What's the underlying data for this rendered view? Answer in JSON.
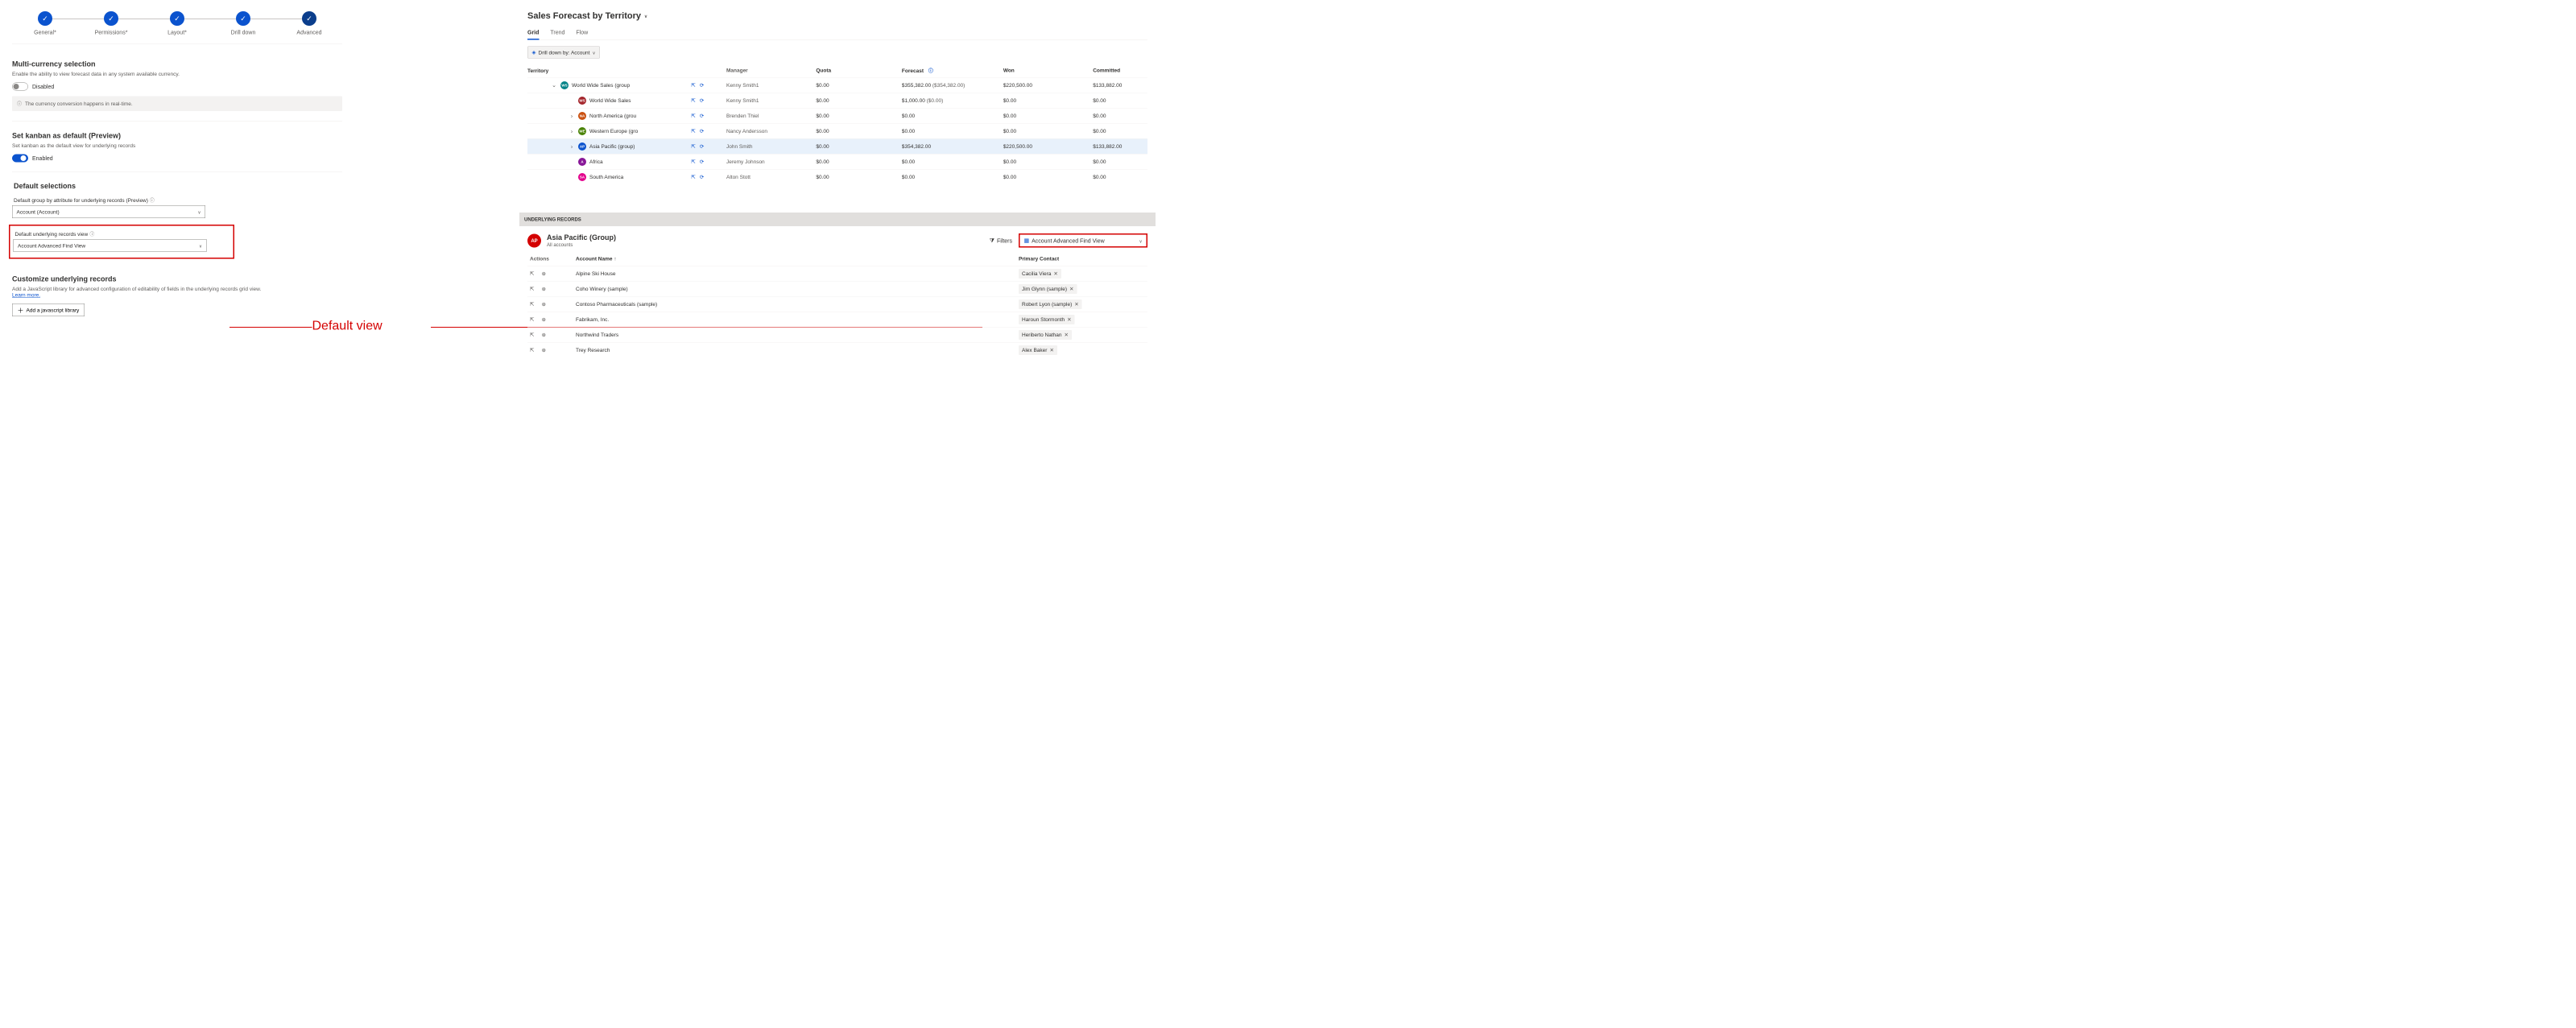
{
  "stepper": {
    "steps": [
      {
        "label": "General*"
      },
      {
        "label": "Permissions*"
      },
      {
        "label": "Layout*"
      },
      {
        "label": "Drill down"
      },
      {
        "label": "Advanced"
      }
    ]
  },
  "multicurrency": {
    "title": "Multi-currency selection",
    "desc": "Enable the ability to view forecast data in any system available currency.",
    "toggle_label": "Disabled",
    "info": "The currency conversion happens in real-time."
  },
  "kanban": {
    "title": "Set kanban as default (Preview)",
    "desc": "Set kanban as the default view for underlying records",
    "toggle_label": "Enabled"
  },
  "defaults": {
    "title": "Default selections",
    "group_by_label": "Default group by attribute for underlying records (Preview)",
    "group_by_value": "Account (Account)",
    "view_label": "Default underlying records view",
    "view_value": "Account Advanced Find View"
  },
  "customize": {
    "title": "Customize underlying records",
    "desc_a": "Add a JavaScript library for advanced configuration of editability of fields in the underlying records grid view. ",
    "learn_more": "Learn more.",
    "button": "Add a javascript library"
  },
  "annotation": {
    "label": "Default view"
  },
  "forecast": {
    "title": "Sales Forecast by Territory",
    "tabs": {
      "grid": "Grid",
      "trend": "Trend",
      "flow": "Flow"
    },
    "drill_label": "Drill down by: Account",
    "columns": {
      "territory": "Territory",
      "manager": "Manager",
      "quota": "Quota",
      "forecast": "Forecast",
      "won": "Won",
      "committed": "Committed"
    },
    "rows": [
      {
        "indent": 0,
        "expand": "d",
        "av": "WS",
        "avbg": "#038387",
        "name": "World Wide Sales (group",
        "mgr": "Kenny Smith1",
        "quota": "$0.00",
        "fc": "$355,382.00",
        "fcp": "($354,382.00)",
        "won": "$220,500.00",
        "comm": "$133,882.00",
        "hl": false
      },
      {
        "indent": 1,
        "expand": "",
        "av": "WS",
        "avbg": "#a4262c",
        "name": "World Wide Sales",
        "mgr": "Kenny Smith1",
        "quota": "$0.00",
        "fc": "$1,000.00",
        "fcp": "($0.00)",
        "won": "$0.00",
        "comm": "$0.00",
        "hl": false
      },
      {
        "indent": 1,
        "expand": "r",
        "av": "NA",
        "avbg": "#ca5010",
        "name": "North America (grou",
        "mgr": "Brenden Thiel",
        "quota": "$0.00",
        "fc": "$0.00",
        "fcp": "",
        "won": "$0.00",
        "comm": "$0.00",
        "hl": false
      },
      {
        "indent": 1,
        "expand": "r",
        "av": "WE",
        "avbg": "#498205",
        "name": "Western Europe (gro",
        "mgr": "Nancy Andersson",
        "quota": "$0.00",
        "fc": "$0.00",
        "fcp": "",
        "won": "$0.00",
        "comm": "$0.00",
        "hl": false
      },
      {
        "indent": 1,
        "expand": "r",
        "av": "AP",
        "avbg": "#0b53ce",
        "name": "Asia Pacific (group)",
        "mgr": "John Smith",
        "quota": "$0.00",
        "fc": "$354,382.00",
        "fcp": "",
        "won": "$220,500.00",
        "comm": "$133,882.00",
        "hl": true
      },
      {
        "indent": 1,
        "expand": "",
        "av": "A",
        "avbg": "#881798",
        "name": "Africa",
        "mgr": "Jeremy Johnson",
        "quota": "$0.00",
        "fc": "$0.00",
        "fcp": "",
        "won": "$0.00",
        "comm": "$0.00",
        "hl": false
      },
      {
        "indent": 1,
        "expand": "",
        "av": "SA",
        "avbg": "#e3008c",
        "name": "South America",
        "mgr": "Alton Stott",
        "quota": "$0.00",
        "fc": "$0.00",
        "fcp": "",
        "won": "$0.00",
        "comm": "$0.00",
        "hl": false
      }
    ]
  },
  "underlying": {
    "bar": "UNDERLYING RECORDS",
    "avatar": "AP",
    "group_title": "Asia Pacific (Group)",
    "group_sub": "All accounts",
    "filters": "Filters",
    "view": "Account Advanced Find View",
    "columns": {
      "actions": "Actions",
      "name": "Account Name",
      "pc": "Primary Contact"
    },
    "rows": [
      {
        "name": "Alpine Ski House",
        "pc": "Cacilia Viera"
      },
      {
        "name": "Coho Winery (sample)",
        "pc": "Jim Glynn (sample)"
      },
      {
        "name": "Contoso Pharmaceuticals (sample)",
        "pc": "Robert Lyon (sample)"
      },
      {
        "name": "Fabrikam, Inc.",
        "pc": "Haroun Stormonth"
      },
      {
        "name": "Northwind Traders",
        "pc": "Heriberto Nathan"
      },
      {
        "name": "Trey Research",
        "pc": "Alex Baker"
      }
    ]
  }
}
